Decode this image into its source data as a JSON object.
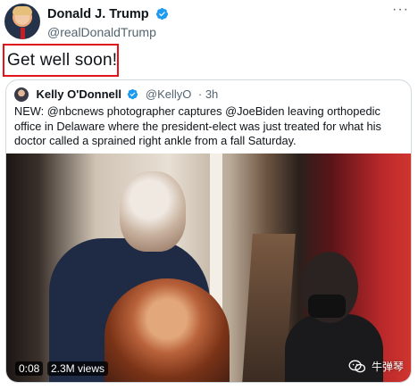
{
  "tweet": {
    "author": {
      "name": "Donald J. Trump",
      "handle": "@realDonaldTrump",
      "verified": true,
      "avatar_icon": "profile-photo"
    },
    "more_icon": "more-horizontal-icon",
    "text": "Get well soon!",
    "highlight_color": "#e0141b"
  },
  "quote": {
    "author": {
      "name": "Kelly O'Donnell",
      "handle": "@KellyO",
      "time": "· 3h",
      "verified": true
    },
    "text": "NEW:  @nbcnews photographer captures @JoeBiden leaving orthopedic office in Delaware where the president-elect was just treated for what his doctor called a sprained right ankle from a fall Saturday.",
    "media": {
      "type": "video",
      "duration": "0:08",
      "views": "2.3M views",
      "watermark": "牛弹琴"
    }
  },
  "colors": {
    "verified_blue": "#1d9bf0",
    "text_primary": "#0f1419",
    "text_secondary": "#536471",
    "border": "#cfd9de"
  }
}
